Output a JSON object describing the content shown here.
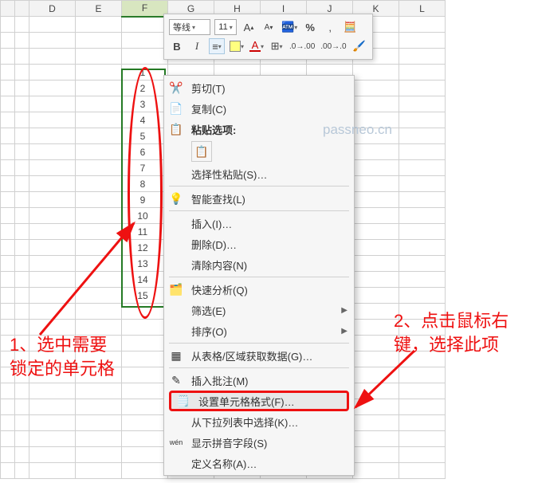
{
  "columns": [
    "D",
    "E",
    "F",
    "G",
    "H",
    "I",
    "J",
    "K",
    "L"
  ],
  "selected_column": "F",
  "cell_values": [
    "1",
    "2",
    "3",
    "4",
    "5",
    "6",
    "7",
    "8",
    "9",
    "10",
    "11",
    "12",
    "13",
    "14",
    "15"
  ],
  "minitoolbar": {
    "font_name": "等线",
    "font_size": "11",
    "grow": "A",
    "shrink": "A",
    "percent": "%",
    "comma": ",",
    "bold": "B",
    "italic": "I",
    "a_red": "A"
  },
  "ctx": {
    "cut": "剪切(T)",
    "copy": "复制(C)",
    "paste_options": "粘贴选项:",
    "paste_special": "选择性粘贴(S)…",
    "smart_lookup": "智能查找(L)",
    "insert": "插入(I)…",
    "delete": "删除(D)…",
    "clear": "清除内容(N)",
    "quick_analysis": "快速分析(Q)",
    "filter": "筛选(E)",
    "sort": "排序(O)",
    "from_table": "从表格/区域获取数据(G)…",
    "insert_comment": "插入批注(M)",
    "format_cells": "设置单元格格式(F)…",
    "dropdown": "从下拉列表中选择(K)…",
    "phonetic": "显示拼音字段(S)",
    "define_name": "定义名称(A)…"
  },
  "watermark": "passneo.cn",
  "annot1_a": "1、选中需要",
  "annot1_b": "锁定的单元格",
  "annot2_a": "2、点击鼠标右",
  "annot2_b": "键，选择此项",
  "chart_data": {
    "type": "table",
    "note": "single column with integers 1..15 selected"
  }
}
